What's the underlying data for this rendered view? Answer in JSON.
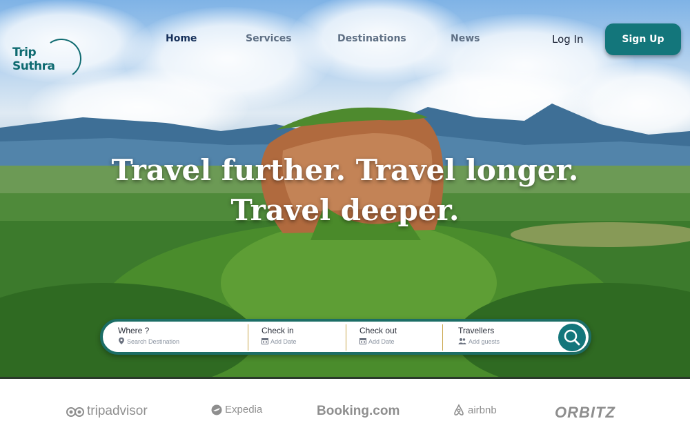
{
  "logo": {
    "text": "Trip Suthra"
  },
  "nav": {
    "home": "Home",
    "services": "Services",
    "destinations": "Destinations",
    "news": "News",
    "login": "Log In",
    "signup": "Sign Up"
  },
  "hero": {
    "headline_line1": "Travel further. Travel longer.",
    "headline_line2": "Travel deeper."
  },
  "search": {
    "where_label": "Where ?",
    "where_placeholder": "Search Destination",
    "checkin_label": "Check in",
    "checkin_placeholder": "Add Date",
    "checkout_label": "Check out",
    "checkout_placeholder": "Add Date",
    "travellers_label": "Travellers",
    "travellers_placeholder": "Add guests"
  },
  "partners": [
    "tripadvisor",
    "Expedia",
    "Booking.com",
    "airbnb",
    "ORBITZ"
  ],
  "colors": {
    "brand_teal": "#13767b",
    "divider_gold": "#c9a64b"
  }
}
